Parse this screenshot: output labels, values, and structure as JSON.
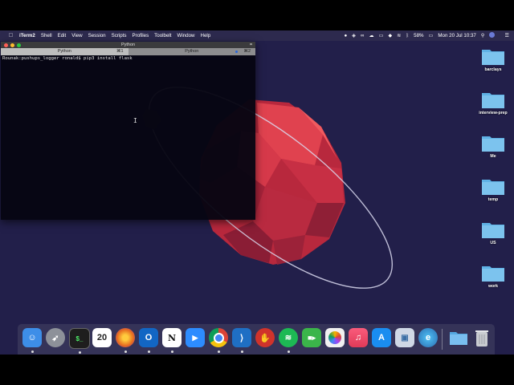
{
  "menubar": {
    "app_name": "iTerm2",
    "items": [
      "Shell",
      "Edit",
      "View",
      "Session",
      "Scripts",
      "Profiles",
      "Toolbelt",
      "Window",
      "Help"
    ],
    "battery": "58%",
    "clock": "Mon 20 Jul  10:37"
  },
  "terminal": {
    "window_title": "Python",
    "tabs": [
      {
        "label": "Python",
        "shortcut": "⌘1"
      },
      {
        "label": "Python",
        "shortcut": "⌘2"
      }
    ],
    "prompt": "Rounak:pushups_logger ronald$ ",
    "command": "pip3 install flask"
  },
  "desktop": {
    "folders": [
      {
        "label": "barclays"
      },
      {
        "label": "interview-prep"
      },
      {
        "label": "Me"
      },
      {
        "label": "temp"
      },
      {
        "label": "US"
      },
      {
        "label": "work"
      }
    ]
  },
  "dock": {
    "calendar_day": "20",
    "apps": [
      {
        "name": "Finder",
        "icon": "finder-icon",
        "color": "#3d8ee8"
      },
      {
        "name": "Launchpad",
        "icon": "rocket-icon",
        "color": "#8d9199"
      },
      {
        "name": "iTerm",
        "icon": "terminal-icon",
        "color": "#1e1e1e"
      },
      {
        "name": "Calendar",
        "icon": "calendar-icon",
        "color": "#ffffff"
      },
      {
        "name": "Firefox",
        "icon": "firefox-icon",
        "color": "#e66a1f"
      },
      {
        "name": "Outlook",
        "icon": "outlook-icon",
        "color": "#1266c4"
      },
      {
        "name": "Notion",
        "icon": "notion-icon",
        "color": "#ffffff"
      },
      {
        "name": "Zoom",
        "icon": "zoom-icon",
        "color": "#2d8cff"
      },
      {
        "name": "Chrome",
        "icon": "chrome-icon",
        "color": "#eeeeee"
      },
      {
        "name": "VS Code",
        "icon": "vscode-icon",
        "color": "#1f6fc4"
      },
      {
        "name": "Hand",
        "icon": "hand-icon",
        "color": "#d0332b"
      },
      {
        "name": "Spotify",
        "icon": "spotify-icon",
        "color": "#1db954"
      },
      {
        "name": "FaceTime",
        "icon": "facetime-icon",
        "color": "#3bb54a"
      },
      {
        "name": "Photos",
        "icon": "photos-icon",
        "color": "#f0f0f0"
      },
      {
        "name": "Music",
        "icon": "music-icon",
        "color": "#f04a62"
      },
      {
        "name": "App Store",
        "icon": "appstore-icon",
        "color": "#1a8df0"
      },
      {
        "name": "Preview",
        "icon": "preview-icon",
        "color": "#cfd8e6"
      },
      {
        "name": "Edge",
        "icon": "edge-icon",
        "color": "#2b6cb0"
      }
    ],
    "extras": [
      {
        "name": "Downloads",
        "icon": "downloads-folder-icon",
        "color": "#54a8e0"
      },
      {
        "name": "Trash",
        "icon": "trash-icon",
        "color": "#c9ccd1"
      }
    ]
  }
}
